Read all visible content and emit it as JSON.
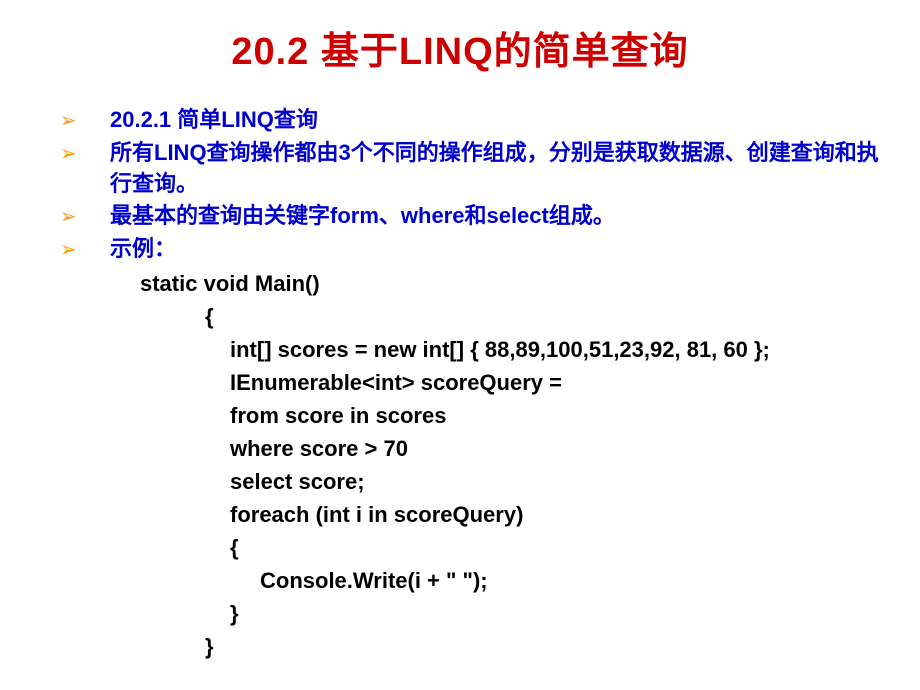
{
  "title": "20.2  基于LINQ的简单查询",
  "bullets": [
    {
      "text": "20.2.1  简单LINQ查询"
    },
    {
      "text": "所有LINQ查询操作都由3个不同的操作组成，分别是获取数据源、创建查询和执行查询。"
    },
    {
      "text": "最基本的查询由关键字form、where和select组成。"
    },
    {
      "text": "示例："
    }
  ],
  "code": {
    "line1": "static void Main()",
    "line2": "{",
    "line3": "int[] scores = new int[] { 88,89,100,51,23,92, 81, 60 };",
    "line4": "IEnumerable<int> scoreQuery =",
    "line5": "from score in scores",
    "line6": "where score > 70",
    "line7": "select score;",
    "line8": "foreach (int i in scoreQuery)",
    "line9": "{",
    "line10": "Console.Write(i + \" \");",
    "line11": "}",
    "line12": "}"
  }
}
